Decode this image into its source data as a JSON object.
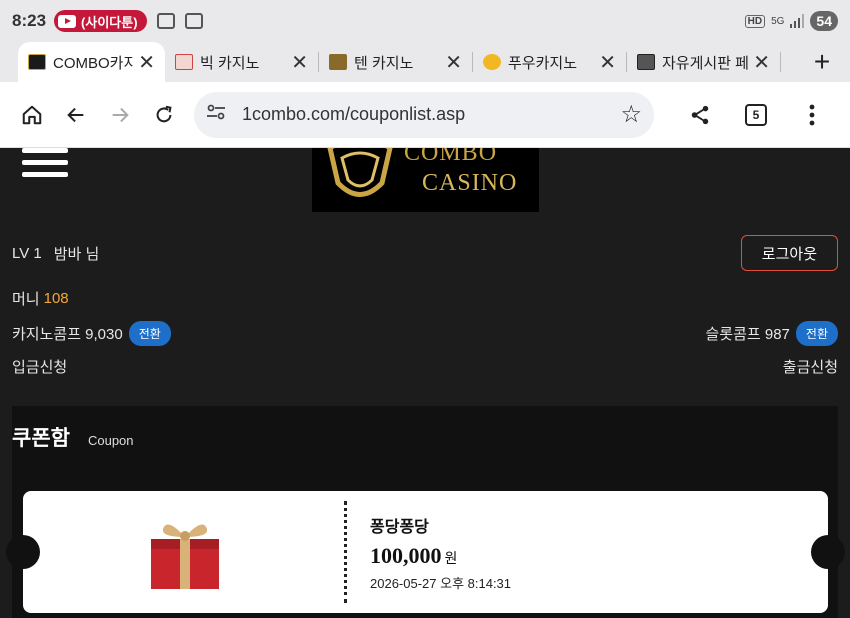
{
  "status_bar": {
    "time": "8:23",
    "youtube_pill": "(사이다툰)",
    "hd": "HD",
    "network": "5G",
    "battery": "54"
  },
  "tabs": [
    {
      "title": "COMBO카지",
      "active": true
    },
    {
      "title": "빅 카지노",
      "active": false
    },
    {
      "title": "텐 카지노",
      "active": false
    },
    {
      "title": "푸우카지노",
      "active": false
    },
    {
      "title": "자유게시판 페",
      "active": false
    }
  ],
  "toolbar": {
    "url": "1combo.com/couponlist.asp",
    "tab_count": "5"
  },
  "logo": {
    "line1": "COMBO",
    "line2": "CASINO"
  },
  "user": {
    "level": "LV 1",
    "name": "밤바 님",
    "logout_label": "로그아웃",
    "money_label": "머니",
    "money_value": "108",
    "casino_comp_label": "카지노콤프 9,030",
    "slot_comp_label": "슬롯콤프 987",
    "convert_label": "전환",
    "deposit_label": "입금신청",
    "withdraw_label": "출금신청"
  },
  "coupon": {
    "title_ko": "쿠폰함",
    "title_en": "Coupon",
    "items": [
      {
        "name": "퐁당퐁당",
        "amount": "100,000",
        "unit": "원",
        "date": "2026-05-27 오후 8:14:31"
      }
    ]
  }
}
